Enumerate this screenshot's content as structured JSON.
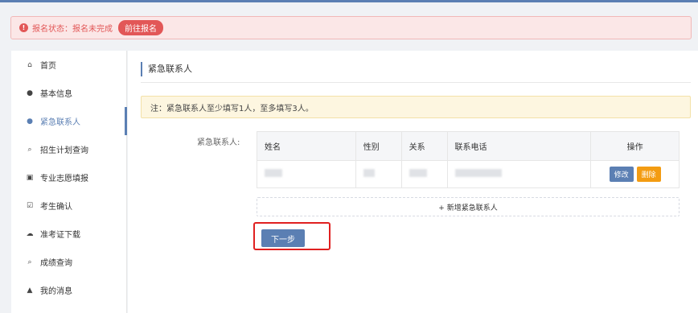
{
  "status": {
    "icon": "exclamation-icon",
    "text": "报名状态：报名未完成",
    "button": "前往报名"
  },
  "sidebar": {
    "items": [
      {
        "label": "首页",
        "icon": "home-icon",
        "glyph": "⌂"
      },
      {
        "label": "基本信息",
        "icon": "user-icon",
        "glyph": "●"
      },
      {
        "label": "紧急联系人",
        "icon": "user-icon",
        "glyph": "●",
        "active": true
      },
      {
        "label": "招生计划查询",
        "icon": "search-icon",
        "glyph": "⌕"
      },
      {
        "label": "专业志愿填报",
        "icon": "form-icon",
        "glyph": "▣"
      },
      {
        "label": "考生确认",
        "icon": "checkbox-icon",
        "glyph": "☑"
      },
      {
        "label": "准考证下载",
        "icon": "cloud-download-icon",
        "glyph": "☁"
      },
      {
        "label": "成绩查询",
        "icon": "search-icon",
        "glyph": "⌕"
      },
      {
        "label": "我的消息",
        "icon": "bell-icon",
        "glyph": "▲"
      }
    ]
  },
  "main": {
    "title": "紧急联系人",
    "notice": "注：紧急联系人至少填写1人，至多填写3人。",
    "field_label": "紧急联系人:",
    "table": {
      "headers": [
        "姓名",
        "性别",
        "关系",
        "联系电话",
        "操作"
      ],
      "actions": {
        "edit": "修改",
        "delete": "删除"
      }
    },
    "add_label": "+ 新增紧急联系人",
    "next_label": "下一步"
  },
  "colors": {
    "accent": "#5b7fb3",
    "danger": "#e25757",
    "warning": "#f39c12",
    "highlight": "#e02020"
  }
}
